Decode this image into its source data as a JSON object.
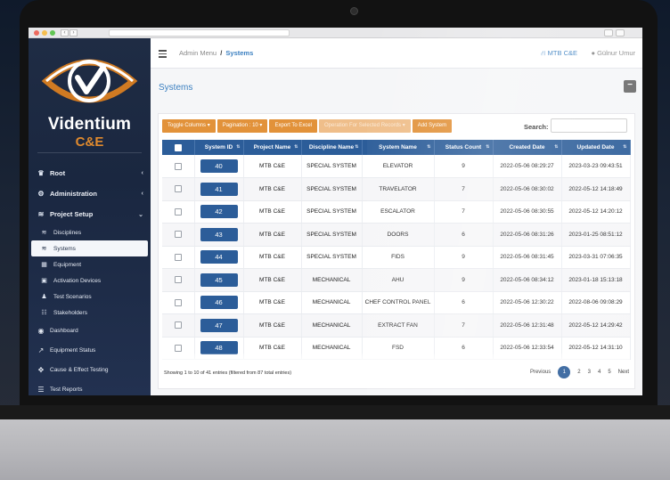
{
  "browser": {
    "back": "‹",
    "forward": "›"
  },
  "brand": {
    "name": "Videntium",
    "sub": "C&E"
  },
  "sidebar": {
    "root": "Root",
    "administration": "Administration",
    "project_setup": "Project Setup",
    "sub_items": [
      {
        "label": "Disciplines",
        "icon": "layers-icon"
      },
      {
        "label": "Systems",
        "icon": "layers-icon"
      },
      {
        "label": "Equipment",
        "icon": "grid-icon"
      },
      {
        "label": "Activation Devices",
        "icon": "device-icon"
      },
      {
        "label": "Test Scenarios",
        "icon": "bell-icon"
      },
      {
        "label": "Stakeholders",
        "icon": "users-icon"
      }
    ],
    "items": [
      {
        "label": "Dashboard",
        "icon": "palette-icon"
      },
      {
        "label": "Equipment Status",
        "icon": "tool-icon"
      },
      {
        "label": "Cause & Effect Testing",
        "icon": "puzzle-icon"
      },
      {
        "label": "Test Reports",
        "icon": "list-icon"
      }
    ]
  },
  "topbar": {
    "breadcrumb_parent": "Admin Menu",
    "breadcrumb_sep": "/",
    "breadcrumb_current": "Systems",
    "org": "MTB C&E",
    "user": "Gülnur Umur"
  },
  "page": {
    "title": "Systems",
    "collapse": "−"
  },
  "toolbar": {
    "toggle_columns": "Toggle Columns",
    "pagination": "Pagination : 10",
    "export": "Export To Excel",
    "operation": "Operation For Selected Records",
    "add": "Add System",
    "search_label": "Search:",
    "search_value": ""
  },
  "table": {
    "headers": [
      "System ID",
      "Project Name",
      "Discipline Name",
      "System Name",
      "Status Count",
      "Created Date",
      "Updated Date"
    ],
    "rows": [
      [
        "40",
        "MTB C&E",
        "SPECIAL SYSTEM",
        "ELEVATOR",
        "9",
        "2022-05-06 08:29:27",
        "2023-03-23 09:43:51"
      ],
      [
        "41",
        "MTB C&E",
        "SPECIAL SYSTEM",
        "TRAVELATOR",
        "7",
        "2022-05-06 08:30:02",
        "2022-05-12 14:18:49"
      ],
      [
        "42",
        "MTB C&E",
        "SPECIAL SYSTEM",
        "ESCALATOR",
        "7",
        "2022-05-06 08:30:55",
        "2022-05-12 14:20:12"
      ],
      [
        "43",
        "MTB C&E",
        "SPECIAL SYSTEM",
        "DOORS",
        "6",
        "2022-05-06 08:31:26",
        "2023-01-25 08:51:12"
      ],
      [
        "44",
        "MTB C&E",
        "SPECIAL SYSTEM",
        "FIDS",
        "9",
        "2022-05-06 08:31:45",
        "2023-03-31 07:06:35"
      ],
      [
        "45",
        "MTB C&E",
        "MECHANICAL",
        "AHU",
        "9",
        "2022-05-06 08:34:12",
        "2023-01-18 15:13:18"
      ],
      [
        "46",
        "MTB C&E",
        "MECHANICAL",
        "CHEF CONTROL PANEL",
        "6",
        "2022-05-06 12:30:22",
        "2022-08-06 09:08:29"
      ],
      [
        "47",
        "MTB C&E",
        "MECHANICAL",
        "EXTRACT FAN",
        "7",
        "2022-05-06 12:31:48",
        "2022-05-12 14:29:42"
      ],
      [
        "48",
        "MTB C&E",
        "MECHANICAL",
        "FSD",
        "6",
        "2022-05-06 12:33:54",
        "2022-05-12 14:31:10"
      ]
    ]
  },
  "footer": {
    "info": "Showing 1 to 10 of 41 entries (filtered from 87 total entries)",
    "previous": "Previous",
    "pages": [
      "1",
      "2",
      "3",
      "4",
      "5"
    ],
    "next": "Next"
  }
}
